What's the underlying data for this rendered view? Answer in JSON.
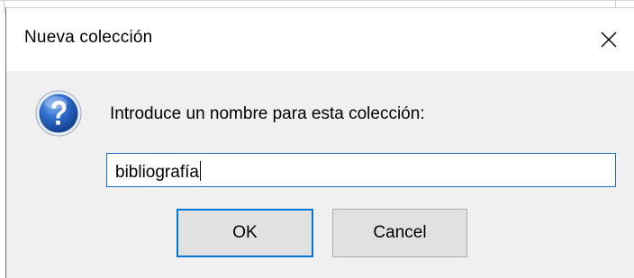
{
  "dialog": {
    "title": "Nueva colección",
    "close_icon": "close-icon",
    "message_icon": "question-icon",
    "prompt": "Introduce un nombre para esta colección:",
    "input": {
      "value": "bibliografía",
      "placeholder": ""
    },
    "ok_label": "OK",
    "cancel_label": "Cancel"
  },
  "colors": {
    "focus_border": "#0078d7",
    "dialog_bg": "#f0f0f0",
    "titlebar_bg": "#ffffff"
  }
}
